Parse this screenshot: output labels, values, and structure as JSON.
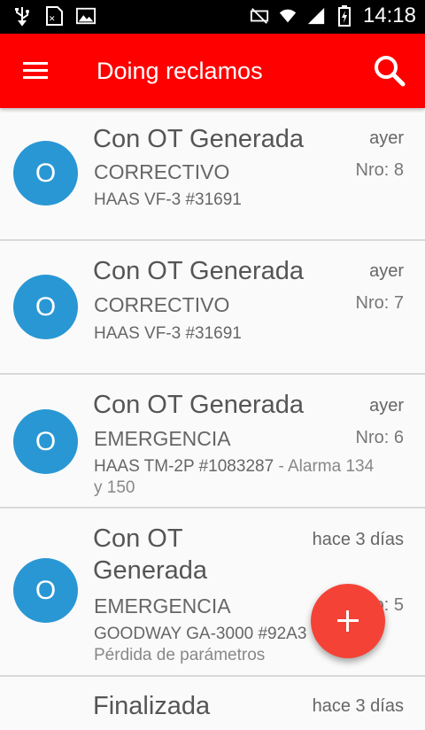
{
  "status_bar": {
    "time": "14:18",
    "icons": [
      "usb-icon",
      "sim-icon",
      "image-icon",
      "mute-icon",
      "wifi-icon",
      "signal-icon",
      "battery-icon"
    ]
  },
  "app_bar": {
    "title": "Doing reclamos",
    "color": "#ff0000",
    "menu_icon": "hamburger-menu-icon",
    "search_icon": "search-icon"
  },
  "reclamos": [
    {
      "avatar": "O",
      "status": "Con OT Generada",
      "type": "CORRECTIVO",
      "machine": "HAAS VF-3 #31691",
      "description": "",
      "when": "ayer",
      "nro_label": "Nro:",
      "nro": "8"
    },
    {
      "avatar": "O",
      "status": "Con OT Generada",
      "type": "CORRECTIVO",
      "machine": "HAAS VF-3 #31691",
      "description": "",
      "when": "ayer",
      "nro_label": "Nro:",
      "nro": "7"
    },
    {
      "avatar": "O",
      "status": "Con OT Generada",
      "type": "EMERGENCIA",
      "machine": "HAAS TM-2P #1083287",
      "description": "- Alarma 134 y 150",
      "when": "ayer",
      "nro_label": "Nro:",
      "nro": "6"
    },
    {
      "avatar": "O",
      "status": "Con OT Generada",
      "type": "EMERGENCIA",
      "machine": "GOODWAY GA-3000 #92A3",
      "description": "Pérdida de parámetros",
      "when": "hace 3 días",
      "nro_label": "Nro:",
      "nro": "5"
    },
    {
      "avatar": "",
      "status": "Finalizada",
      "type": "",
      "machine": "",
      "description": "",
      "when": "hace 3 días",
      "nro_label": "",
      "nro": ""
    }
  ],
  "fab": {
    "icon": "plus-icon",
    "color": "#f44336"
  },
  "avatar_color": "#2997d4"
}
